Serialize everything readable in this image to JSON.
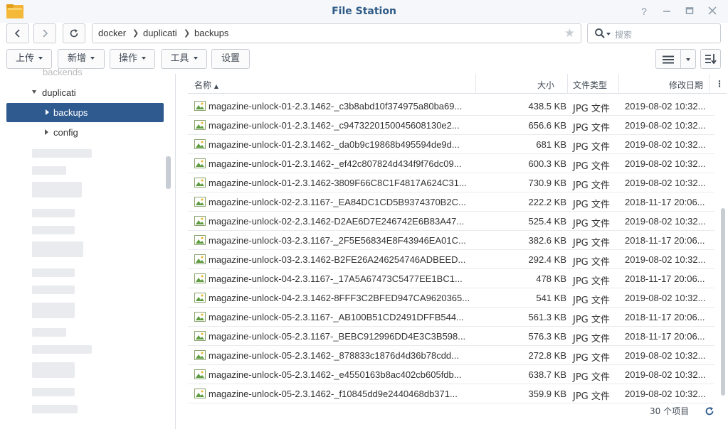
{
  "window": {
    "title": "File Station"
  },
  "path": {
    "segments": [
      "docker",
      "duplicati",
      "backups"
    ]
  },
  "search": {
    "placeholder": "搜索"
  },
  "toolbar": {
    "upload": "上传",
    "create": "新增",
    "action": "操作",
    "tools": "工具",
    "settings": "设置"
  },
  "sidebar": {
    "cut_top": "backends",
    "parent": "duplicati",
    "selected": "backups",
    "sibling": "config"
  },
  "columns": {
    "name": "名称",
    "size": "大小",
    "type": "文件类型",
    "modified": "修改日期"
  },
  "files": [
    {
      "name": "magazine-unlock-01-2.3.1462-_c3b8abd10f374975a80ba69...",
      "size": "438.5 KB",
      "type": "JPG 文件",
      "modified": "2019-08-02 10:32..."
    },
    {
      "name": "magazine-unlock-01-2.3.1462-_c9473220150045608130e2...",
      "size": "656.6 KB",
      "type": "JPG 文件",
      "modified": "2019-08-02 10:32..."
    },
    {
      "name": "magazine-unlock-01-2.3.1462-_da0b9c19868b495594de9d...",
      "size": "681 KB",
      "type": "JPG 文件",
      "modified": "2019-08-02 10:32..."
    },
    {
      "name": "magazine-unlock-01-2.3.1462-_ef42c807824d434f9f76dc09...",
      "size": "600.3 KB",
      "type": "JPG 文件",
      "modified": "2019-08-02 10:32..."
    },
    {
      "name": "magazine-unlock-01-2.3.1462-3809F66C8C1F4817A624C31...",
      "size": "730.9 KB",
      "type": "JPG 文件",
      "modified": "2019-08-02 10:32..."
    },
    {
      "name": "magazine-unlock-02-2.3.1167-_EA84DC1CD5B9374370B2C...",
      "size": "222.2 KB",
      "type": "JPG 文件",
      "modified": "2018-11-17 20:06..."
    },
    {
      "name": "magazine-unlock-02-2.3.1462-D2AE6D7E246742E6B83A47...",
      "size": "525.4 KB",
      "type": "JPG 文件",
      "modified": "2019-08-02 10:32..."
    },
    {
      "name": "magazine-unlock-03-2.3.1167-_2F5E56834E8F43946EA01C...",
      "size": "382.6 KB",
      "type": "JPG 文件",
      "modified": "2018-11-17 20:06..."
    },
    {
      "name": "magazine-unlock-03-2.3.1462-B2FE26A246254746ADBEED...",
      "size": "292.4 KB",
      "type": "JPG 文件",
      "modified": "2019-08-02 10:32..."
    },
    {
      "name": "magazine-unlock-04-2.3.1167-_17A5A67473C5477EE1BC1...",
      "size": "478 KB",
      "type": "JPG 文件",
      "modified": "2018-11-17 20:06..."
    },
    {
      "name": "magazine-unlock-04-2.3.1462-8FFF3C2BFED947CA9620365...",
      "size": "541 KB",
      "type": "JPG 文件",
      "modified": "2019-08-02 10:32..."
    },
    {
      "name": "magazine-unlock-05-2.3.1167-_AB100B51CD2491DFFB544...",
      "size": "561.3 KB",
      "type": "JPG 文件",
      "modified": "2018-11-17 20:06..."
    },
    {
      "name": "magazine-unlock-05-2.3.1167-_BEBC912996DD4E3C3B598...",
      "size": "576.3 KB",
      "type": "JPG 文件",
      "modified": "2018-11-17 20:06..."
    },
    {
      "name": "magazine-unlock-05-2.3.1462-_878833c1876d4d36b78cdd...",
      "size": "272.8 KB",
      "type": "JPG 文件",
      "modified": "2019-08-02 10:32..."
    },
    {
      "name": "magazine-unlock-05-2.3.1462-_e4550163b8ac402cb605fdb...",
      "size": "638.7 KB",
      "type": "JPG 文件",
      "modified": "2019-08-02 10:32..."
    },
    {
      "name": "magazine-unlock-05-2.3.1462-_f10845dd9e2440468db371...",
      "size": "359.9 KB",
      "type": "JPG 文件",
      "modified": "2019-08-02 10:32..."
    }
  ],
  "status": {
    "count": "30 个项目"
  },
  "icons": {
    "app": "folder-icon",
    "back": "chevron-left-icon",
    "forward": "chevron-right-icon",
    "refresh": "refresh-icon",
    "star": "star-icon",
    "search": "search-icon",
    "file": "image-file-icon",
    "list_view": "list-view-icon",
    "sort": "sort-icon"
  },
  "colors": {
    "title": "#2e5a86",
    "selected": "#2f5a8f"
  }
}
